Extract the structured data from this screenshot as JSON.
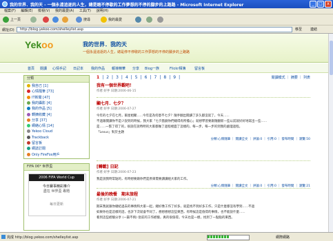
{
  "window": {
    "title": "我的世界．我的天 - 一個永遠追逐的人生，總是踏不停歇的工作夢想的不停的腳步的上路路 - Microsoft Internet Explorer",
    "minimize": "_",
    "maximize": "□",
    "close": "x"
  },
  "menu": [
    "檔案(F)",
    "編輯(E)",
    "檢視(V)",
    "我的最愛(A)",
    "工具(T)",
    "說明(H)"
  ],
  "toolbar": {
    "back": "上一頁",
    "search": "搜尋",
    "favorites": "我的最愛"
  },
  "address": {
    "label": "網址(D)",
    "value": "http://blog.yekoo.com/shelleylist.asp",
    "go": "移至",
    "links": "連結"
  },
  "site": {
    "logo_main": "Yek",
    "logo_o": "oo",
    "title": "我的世界．我的天",
    "slogan": "一個永遠追逐的人生，總是停不停歇的工作夢想的不停的腳步的上路路"
  },
  "nav": [
    "首頁",
    "閱讀",
    "心情手記",
    "日記本",
    "我的作品",
    "報導精華",
    "分享",
    "Blog一族",
    "Flickr相簿",
    "留言板"
  ],
  "sidebar": {
    "categories_title": "分類",
    "categories": [
      {
        "label": "我自己 [1]",
        "color": "#e2b300"
      },
      {
        "label": "心情隨筆 [73]",
        "color": "#d7262b"
      },
      {
        "label": "IT新聞 [47]",
        "color": "#f18f00"
      },
      {
        "label": "我的攝影 [4]",
        "color": "#6aa84f"
      },
      {
        "label": "我的作品 [5]",
        "color": "#0b7dc1"
      },
      {
        "label": "轉摘收藏 [4]",
        "color": "#9b59b6"
      },
      {
        "label": "分享 [37]",
        "color": "#e67e22"
      },
      {
        "label": "網絡心情 [14]",
        "color": "#2ecc71"
      },
      {
        "label": "Yekoo Cloud",
        "color": "#888888"
      },
      {
        "label": "Trackback",
        "color": "#555555"
      },
      {
        "label": "留言板",
        "color": "#c0392b"
      },
      {
        "label": "網誌訂閱",
        "color": "#16a085"
      },
      {
        "label": "Only FireFox用戶",
        "color": "#e67e22"
      }
    ],
    "fifa_title": "FIFA 06* 世界盃",
    "fifa_banner_top": "2006 FIFA World Cup",
    "fifa_line1": "今日賽事精彩推介",
    "fifa_line2": "盡在 世界盃 專題",
    "fifa_line3": "每日更新"
  },
  "main": {
    "pages": [
      "1",
      "2",
      "3",
      "4",
      "5",
      "6",
      "7",
      "8",
      "9"
    ],
    "current_page": "1",
    "tools": "閱讀模式 ｜ 摘要 ｜ 列表",
    "posts": [
      {
        "title": "我有一個世界觀吧！",
        "meta": "作者 好手 日期:2006-06-15",
        "body": [],
        "foot": ""
      },
      {
        "title": "顯七月．七夕？",
        "meta": "作者 好手 日期:2006-07-27",
        "body": [
          "今年的七夕在七月，兩星相聚......今年是為何意不七夕？隨手翻出閱讀了許久都沒寫了，今天......",
          "不過跟閱讀你不是少說到的時候，我大家「七夕戲劇你們總得有所擔心」就想學習要跟隨翻新一些以前就好好地寫出一些......",
          "是......一張了得了的，很說在說時時的大家都做了過程裡面了這樣的，每一步，每一步的到我的處理過程。",
          "「Lexus」對於主題"
        ],
        "foot": "分類:心情隨筆 ｜ 閱讀全文 ｜ 評論:0 ｜ 引用:0 ｜ 發布時間 ｜ 瀏覽:50"
      },
      {
        "title": "[轉載] 日記",
        "meta": "作者 好手 日期:2006-07-23",
        "body": [
          "我是說我時常點的，有時想要跟你們是原來需要讀讀給大家的工作。"
        ],
        "foot": "分類:心情隨筆 ｜ 閱讀全文 ｜ 評論:0 ｜ 引用:0 ｜ 發布時間 ｜ 瀏覽:21"
      },
      {
        "title": "最後的晚餐　期末旅程",
        "meta": "作者 好手 日期:2006-07-21",
        "body": [
          "期末我就跟你總結過去的事情和大家一起，總好像工作了好多，就是找不到好多工作，只是什麼都沒有學到......不過",
          "如果你也是這樣的話，也許下次就會不同了，想想想想這些東西，有時候這是值得的事情，也不能說什麼......",
          "看到這些經驗分享 (一篇不夠) 從前的工作經驗，真的很值得。今天也是一樣，找到了一點點的東西。"
        ],
        "foot": ""
      }
    ]
  },
  "status": {
    "text": "完成 http://blog.yekoo.com/shelleylist.asp",
    "zone": "網際網路",
    "progress": 0.55
  }
}
